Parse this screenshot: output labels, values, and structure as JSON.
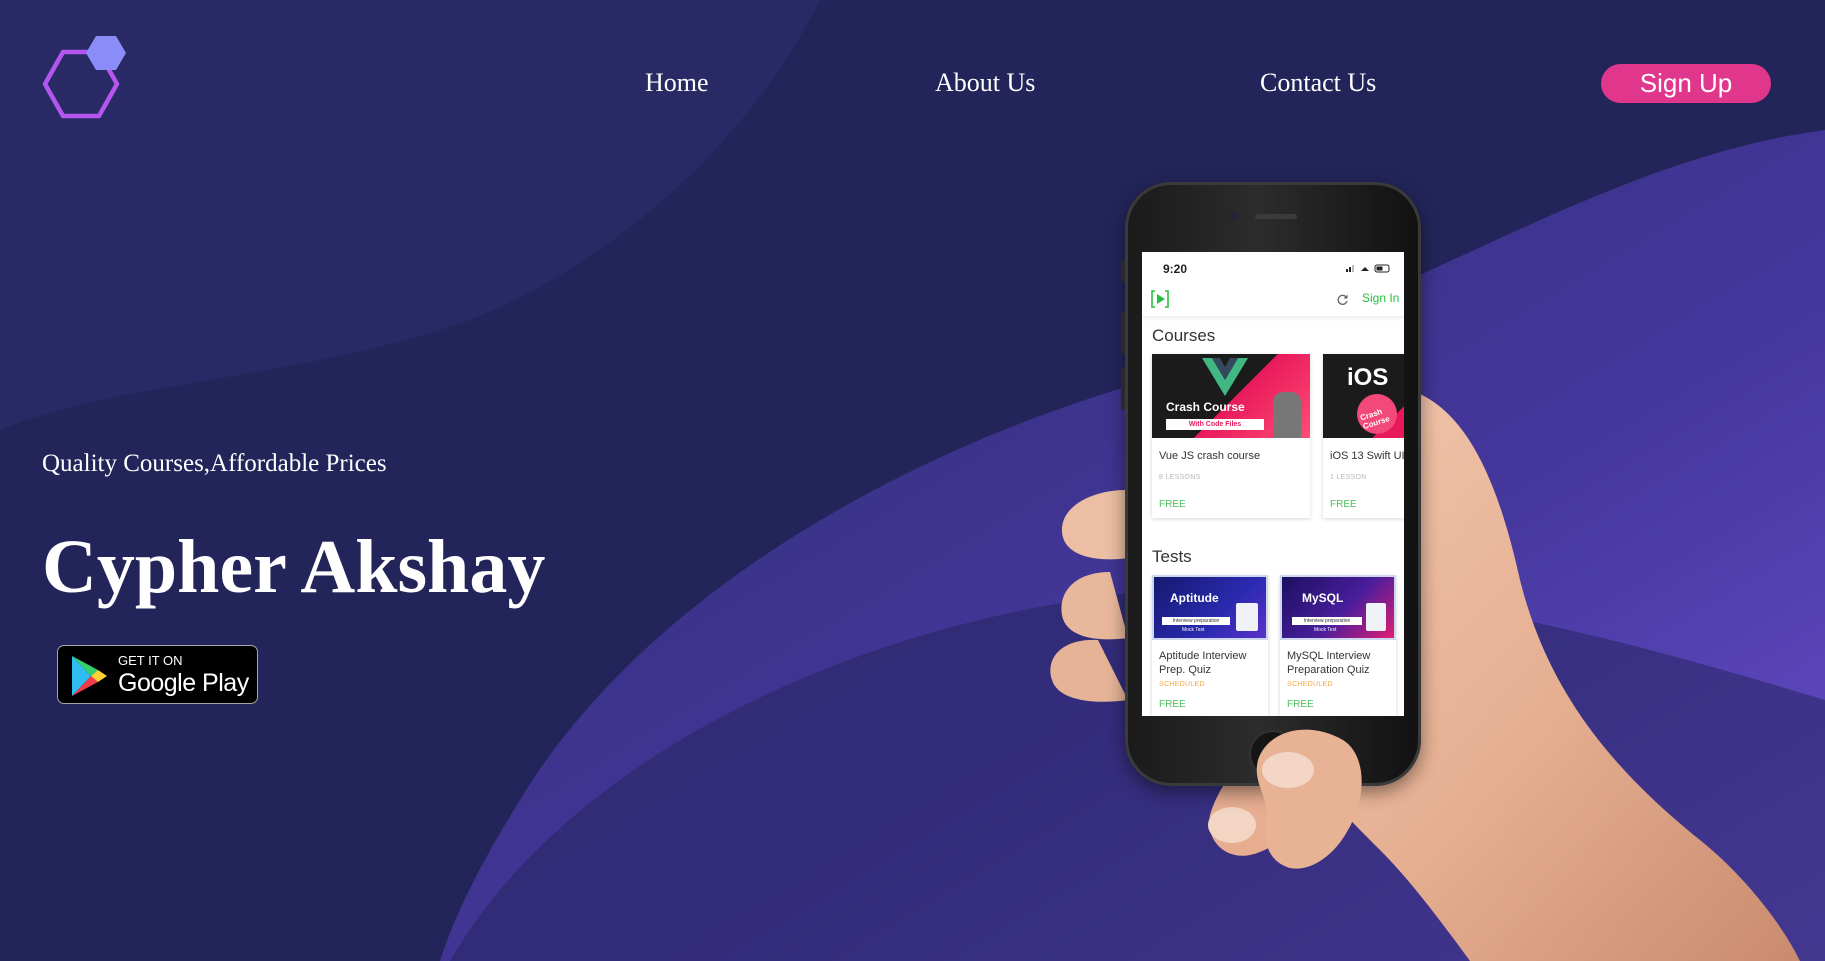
{
  "header": {
    "nav": {
      "home": "Home",
      "about": "About Us",
      "contact": "Contact Us"
    },
    "signup_label": "Sign Up"
  },
  "hero": {
    "tagline": "Quality Courses,Affordable Prices",
    "title": "Cypher Akshay",
    "store_badge": {
      "small": "GET IT ON",
      "big": "Google Play"
    }
  },
  "phone_app": {
    "time": "9:20",
    "signin_label": "Sign In",
    "courses_title": "Courses",
    "courses": [
      {
        "thumb_title": "Crash Course",
        "thumb_sub": "With Code Files",
        "name": "Vue JS crash course",
        "lessons": "8 LESSONS",
        "price": "FREE"
      },
      {
        "thumb_title": "iOS",
        "thumb_sub": "Crash Course",
        "name": "iOS 13 Swift UI",
        "lessons": "1 LESSON",
        "price": "FREE"
      }
    ],
    "tests_title": "Tests",
    "tests": [
      {
        "thumb_title": "Aptitude",
        "thumb_sub": "Interview preparation",
        "thumb_tag": "Mock Test",
        "name": "Aptitude Interview Prep. Quiz",
        "status": "SCHEDULED",
        "price": "FREE"
      },
      {
        "thumb_title": "MySQL",
        "thumb_sub": "Interview preparation",
        "thumb_tag": "Mock Test",
        "name": "MySQL Interview Preparation Quiz",
        "status": "SCHEDULED",
        "price": "FREE"
      }
    ]
  },
  "colors": {
    "background": "#23255a",
    "accent": "#e0368b",
    "logo": "#b455f0",
    "logo_small_hex": "#8a8cf8",
    "app_green": "#26c041"
  },
  "icons": {
    "logo": "hexagon-logo-icon",
    "store": "google-play-icon",
    "app_logo": "play-bracket-icon",
    "refresh": "refresh-icon"
  }
}
